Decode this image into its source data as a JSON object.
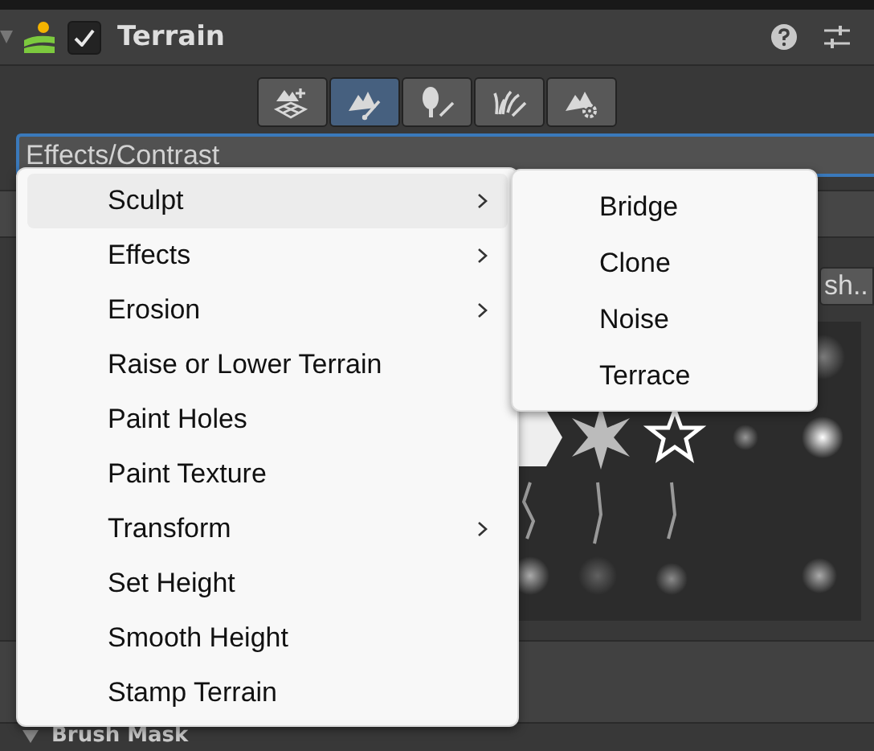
{
  "component": {
    "title": "Terrain",
    "enabled": true,
    "expanded": true
  },
  "tools": [
    {
      "kind": "create",
      "selected": false
    },
    {
      "kind": "sculpt",
      "selected": true
    },
    {
      "kind": "trees",
      "selected": false
    },
    {
      "kind": "details",
      "selected": false
    },
    {
      "kind": "settings",
      "selected": false
    }
  ],
  "tool_dropdown": {
    "value": "Effects/Contrast"
  },
  "brush_button": {
    "label": "sh.."
  },
  "brush_mask": {
    "title": "Brush Mask"
  },
  "menu": [
    {
      "label": "Sculpt",
      "submenu": true,
      "selected": true
    },
    {
      "label": "Effects",
      "submenu": true,
      "selected": false
    },
    {
      "label": "Erosion",
      "submenu": true,
      "selected": false
    },
    {
      "label": "Raise or Lower Terrain",
      "submenu": false,
      "selected": false
    },
    {
      "label": "Paint Holes",
      "submenu": false,
      "selected": false
    },
    {
      "label": "Paint Texture",
      "submenu": false,
      "selected": false
    },
    {
      "label": "Transform",
      "submenu": true,
      "selected": false
    },
    {
      "label": "Set Height",
      "submenu": false,
      "selected": false
    },
    {
      "label": "Smooth Height",
      "submenu": false,
      "selected": false
    },
    {
      "label": "Stamp Terrain",
      "submenu": false,
      "selected": false
    }
  ],
  "submenu": [
    "Bridge",
    "Clone",
    "Noise",
    "Terrace"
  ]
}
